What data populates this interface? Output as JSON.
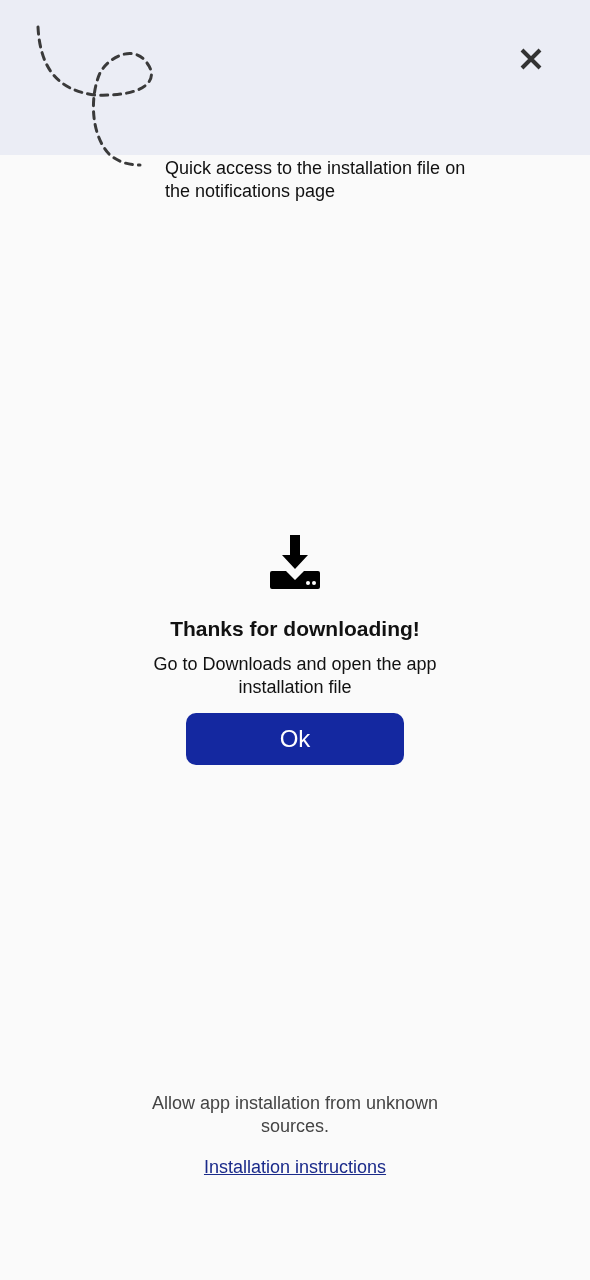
{
  "hint": {
    "text": "Quick access to the installation file on the notifications page"
  },
  "dialog": {
    "title": "Thanks for downloading!",
    "message": "Go to Downloads and open the app installation file",
    "button": "Ok"
  },
  "footer": {
    "note": "Allow app installation from unknown sources.",
    "link": "Installation instructions"
  }
}
